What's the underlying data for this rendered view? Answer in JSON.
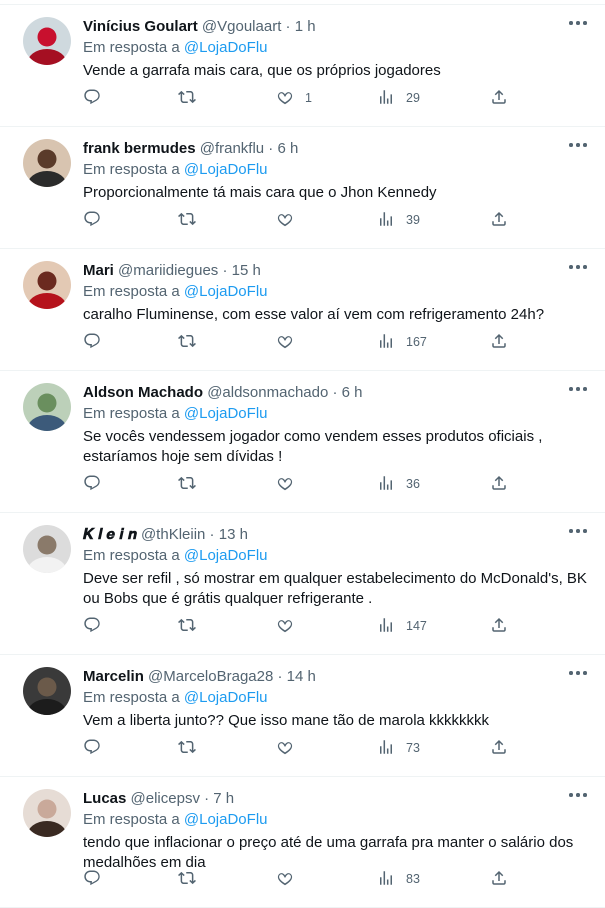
{
  "reply_prefix": "Em resposta a",
  "colors": {
    "text": "#0f1419",
    "secondary": "#536471",
    "link": "#1d9bf0",
    "divider": "#eff3f4"
  },
  "icons": [
    "reply-icon",
    "retweet-icon",
    "like-icon",
    "views-icon",
    "share-icon",
    "more-icon"
  ],
  "tweets": [
    {
      "name": "Vinícius Goulart",
      "handle": "@Vgoulaart",
      "time": "1 h",
      "reply_to": "@LojaDoFlu",
      "text": [
        "Vende a garrafa mais cara, que os próprios jogadores"
      ],
      "likes": "1",
      "views": "29"
    },
    {
      "name": "frank bermudes",
      "handle": "@frankflu",
      "time": "6 h",
      "reply_to": "@LojaDoFlu",
      "text": [
        "Proporcionalmente tá mais cara que o Jhon Kennedy"
      ],
      "likes": "",
      "views": "39"
    },
    {
      "name": "Mari",
      "handle": "@mariidiegues",
      "time": "15 h",
      "reply_to": "@LojaDoFlu",
      "text": [
        "caralho Fluminense, com esse valor aí vem com refrigeramento 24h?"
      ],
      "likes": "",
      "views": "167"
    },
    {
      "name": "Aldson Machado",
      "handle": "@aldsonmachado",
      "time": "6 h",
      "reply_to": "@LojaDoFlu",
      "text": [
        "Se vocês vendessem jogador como vendem esses produtos oficiais ,",
        "estaríamos hoje sem dívidas !"
      ],
      "likes": "",
      "views": "36"
    },
    {
      "name": "𝑲 𝒍 𝒆 𝒊 𝒏",
      "handle": "@thKleiin",
      "time": "13 h",
      "reply_to": "@LojaDoFlu",
      "text": [
        "Deve ser refil , só mostrar em qualquer estabelecimento do McDonald's, BK",
        "ou Bobs que é grátis qualquer refrigerante ."
      ],
      "likes": "",
      "views": "147"
    },
    {
      "name": "Marcelin",
      "handle": "@MarceloBraga28",
      "time": "14 h",
      "reply_to": "@LojaDoFlu",
      "text": [
        "Vem a liberta junto?? Que isso mane tão de marola kkkkkkkk"
      ],
      "likes": "",
      "views": "73"
    },
    {
      "name": "Lucas",
      "handle": "@elicepsv",
      "time": "7 h",
      "reply_to": "@LojaDoFlu",
      "text": [
        "tendo que inflacionar o preço até de uma garrafa pra manter o salário dos",
        "medalhões em dia"
      ],
      "likes": "",
      "views": "83"
    }
  ]
}
